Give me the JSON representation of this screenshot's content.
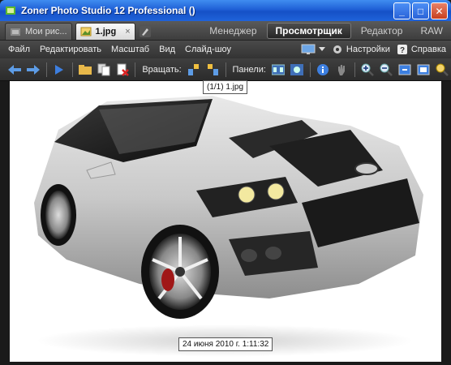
{
  "window": {
    "title": "Zoner Photo Studio 12 Professional  ()",
    "minimize": "_",
    "maximize": "□",
    "close": "✕"
  },
  "tabs": {
    "docs": [
      {
        "label": "Мои рис...",
        "icon": "folder-picture-icon",
        "active": false
      },
      {
        "label": "1.jpg",
        "icon": "image-icon",
        "active": true
      }
    ],
    "close_glyph": "×",
    "modes": [
      {
        "label": "Менеджер",
        "active": false
      },
      {
        "label": "Просмотрщик",
        "active": true
      },
      {
        "label": "Редактор",
        "active": false
      },
      {
        "label": "RAW",
        "active": false
      }
    ]
  },
  "menu": {
    "items": [
      "Файл",
      "Редактировать",
      "Масштаб",
      "Вид",
      "Слайд-шоу"
    ],
    "settings": "Настройки",
    "help": "Справка"
  },
  "toolbar": {
    "rotate_label": "Вращать:",
    "panels_label": "Панели:"
  },
  "viewer": {
    "image_label": "(1/1) 1.jpg",
    "date_label": "24 июня 2010 г. 1:11:32"
  }
}
